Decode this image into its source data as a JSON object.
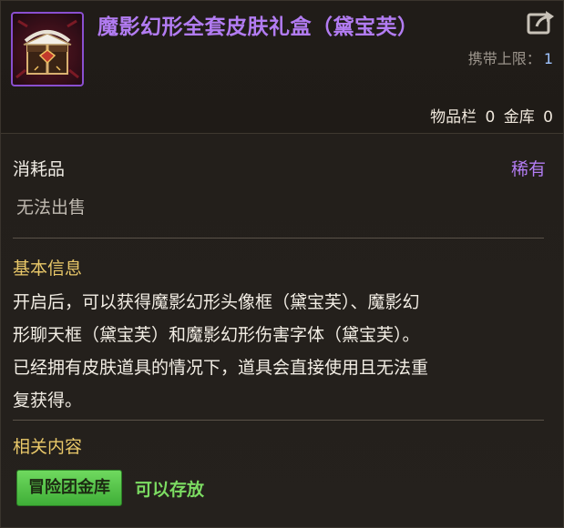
{
  "item": {
    "name": "魔影幻形全套皮肤礼盒（黛宝芙）",
    "icon": "gift-box-icon",
    "carry_limit_label": "携带上限：",
    "carry_limit_value": "1",
    "inventory_label": "物品栏",
    "inventory_count": "0",
    "vault_label": "金库",
    "vault_count": "0"
  },
  "type_section": {
    "type": "消耗品",
    "rarity": "稀有",
    "sell_status": "无法出售"
  },
  "basic_info": {
    "title": "基本信息",
    "description_lines": [
      "开启后，可以获得魔影幻形头像框（黛宝芙）、魔影幻",
      "形聊天框（黛宝芙）和魔影幻形伤害字体（黛宝芙）。",
      "已经拥有皮肤道具的情况下，道具会直接使用且无法重",
      "复获得。"
    ]
  },
  "related": {
    "title": "相关内容",
    "tag_label": "冒险团金库",
    "tag_status": "可以存放"
  },
  "colors": {
    "rare_purple": "#b27cf2",
    "section_gold": "#e9c869",
    "storable_green": "#7cdc62"
  }
}
